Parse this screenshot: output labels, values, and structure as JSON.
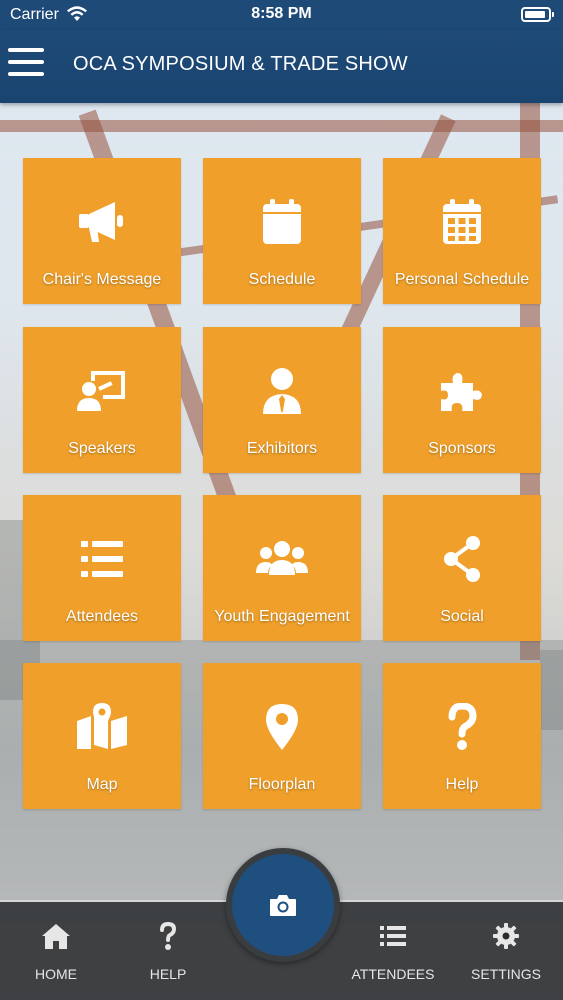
{
  "status_bar": {
    "carrier": "Carrier",
    "time": "8:58 PM"
  },
  "app_bar": {
    "title": "OCA SYMPOSIUM & TRADE SHOW"
  },
  "tiles": [
    {
      "label": "Chair's Message",
      "icon": "megaphone-icon"
    },
    {
      "label": "Schedule",
      "icon": "calendar-icon"
    },
    {
      "label": "Personal Schedule",
      "icon": "calendar-grid-icon"
    },
    {
      "label": "Speakers",
      "icon": "presenter-icon"
    },
    {
      "label": "Exhibitors",
      "icon": "user-tie-icon"
    },
    {
      "label": "Sponsors",
      "icon": "puzzle-icon"
    },
    {
      "label": "Attendees",
      "icon": "list-icon"
    },
    {
      "label": "Youth Engagement",
      "icon": "group-icon"
    },
    {
      "label": "Social",
      "icon": "share-icon"
    },
    {
      "label": "Map",
      "icon": "map-icon"
    },
    {
      "label": "Floorplan",
      "icon": "map-pin-icon"
    },
    {
      "label": "Help",
      "icon": "question-icon"
    }
  ],
  "tab_bar": {
    "items": [
      {
        "label": "HOME",
        "icon": "home-icon"
      },
      {
        "label": "HELP",
        "icon": "question-icon"
      },
      {
        "label": "ATTENDEES",
        "icon": "list-icon"
      },
      {
        "label": "SETTINGS",
        "icon": "gear-icon"
      }
    ],
    "center_button_icon": "camera-icon"
  },
  "colors": {
    "header": "#1e4a78",
    "tile": "#f0a02a",
    "tab_bar": "#2a2c2e",
    "camera_button": "#1f4f7f"
  }
}
